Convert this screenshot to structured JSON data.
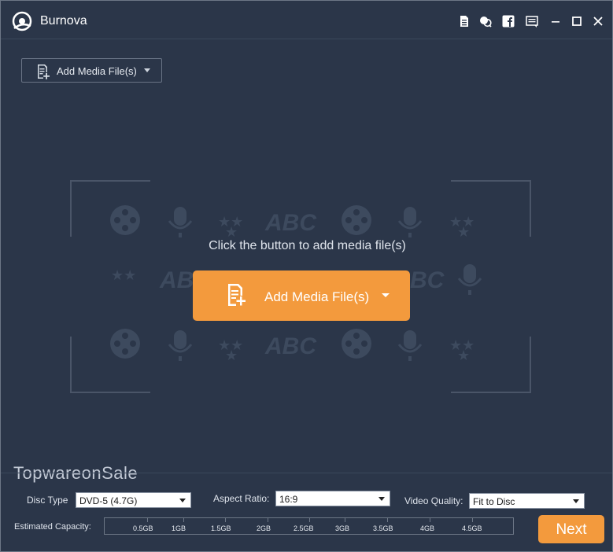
{
  "app": {
    "title": "Burnova"
  },
  "titlebar": {
    "icons": [
      "document-icon",
      "feedback-icon",
      "facebook-icon",
      "menu-icon",
      "minimize-icon",
      "maximize-icon",
      "close-icon"
    ]
  },
  "toolbar": {
    "add_media_label": "Add Media File(s)"
  },
  "main": {
    "prompt": "Click the button to add media file(s)",
    "add_media_label": "Add Media File(s)",
    "watermark_text": "ABC"
  },
  "brand_watermark": "TopwareonSale",
  "settings": {
    "disc_type": {
      "label": "Disc Type",
      "value": "DVD-5 (4.7G)"
    },
    "aspect_ratio": {
      "label": "Aspect Ratio:",
      "value": "16:9"
    },
    "video_quality": {
      "label": "Video Quality:",
      "value": "Fit to Disc"
    }
  },
  "capacity": {
    "label": "Estimated Capacity:",
    "ticks": [
      "0.5GB",
      "1GB",
      "1.5GB",
      "2GB",
      "2.5GB",
      "3GB",
      "3.5GB",
      "4GB",
      "4.5GB"
    ]
  },
  "footer": {
    "next_label": "Next"
  },
  "colors": {
    "background": "#2b3649",
    "accent": "#f39a3d",
    "border": "#6d7786"
  }
}
